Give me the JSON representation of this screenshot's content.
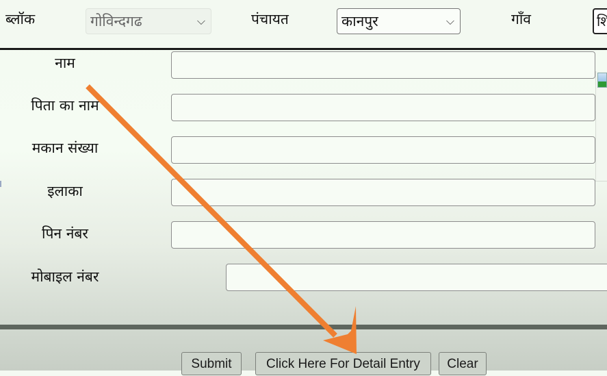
{
  "header": {
    "block_label": "ब्लॉक",
    "block_select_value": "गोविन्दगढ",
    "panchayat_label": "पंचायत",
    "panchayat_select_value": "कानपुर",
    "village_label": "गाँव",
    "village_select_value_partial": "शि",
    "chevron_icon": "⌵"
  },
  "form": {
    "fields": [
      {
        "label": "नाम",
        "value": ""
      },
      {
        "label": "पिता का नाम",
        "value": ""
      },
      {
        "label": "मकान संख्या",
        "value": ""
      },
      {
        "label": "इलाका",
        "value": ""
      },
      {
        "label": "पिन नंबर",
        "value": ""
      },
      {
        "label": "मोबाइल नंबर",
        "value": ""
      }
    ]
  },
  "buttons": {
    "submit": "Submit",
    "detail_entry": "Click Here For Detail Entry",
    "clear": "Clear"
  },
  "annotation": {
    "arrow_color": "#ef7f31",
    "points_to": "Click Here For Detail Entry"
  },
  "colors": {
    "divider": "#5e665e",
    "accent_arrow": "#ef7f31"
  }
}
